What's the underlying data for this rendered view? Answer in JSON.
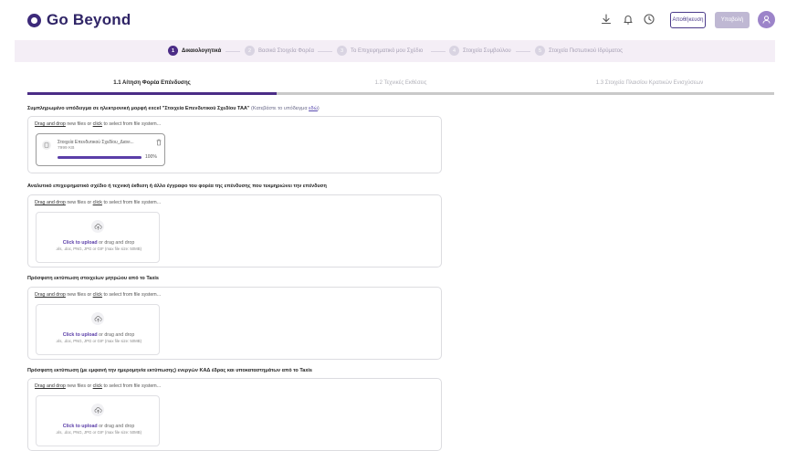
{
  "app": {
    "name": "Go Beyond"
  },
  "header": {
    "save_label": "Αποθήκευση",
    "submit_label": "Υποβολή",
    "icons": [
      "download-icon",
      "bell-icon",
      "clock-icon",
      "user-icon"
    ]
  },
  "steps": [
    {
      "num": "1",
      "label": "Δικαιολογητικά"
    },
    {
      "num": "2",
      "label": "Βασικά Στοιχεία Φορέα"
    },
    {
      "num": "3",
      "label": "Το Επιχειρηματικό μου Σχέδιο"
    },
    {
      "num": "4",
      "label": "Στοιχεία Συμβούλου"
    },
    {
      "num": "5",
      "label": "Στοιχεία Πιστωτικού Ιδρύματος"
    }
  ],
  "subtabs": [
    {
      "label": "1.1 Αίτηση Φορέα Επένδυσης"
    },
    {
      "label": "1.2 Τεχνικές Εκθέσεις"
    },
    {
      "label": "1.3 Στοιχεία Πλαισίου Κρατικών Ενισχύσεων"
    }
  ],
  "sections": [
    {
      "title": "Συμπληρωμένο υπόδειγμα σε ηλεκτρονική μορφή excel \"Στοιχεία Επενδυτικού Σχεδίου ΤΑΑ\"",
      "note_prefix": "(Κατεβάστε το υπόδειγμα",
      "note_link": "εδώ",
      "note_suffix": ")",
      "hint_drag": "Drag and drop",
      "hint_mid": "new files or",
      "hint_click": "click",
      "hint_end": "to select from file system...",
      "file": {
        "name": "Στοιχεία Επενδυτικού Σχεδίου_Διανι...",
        "size": "7999 KB",
        "progress_label": "100%",
        "progress": 1.0
      }
    },
    {
      "title": "Αναλυτικό επιχειρηματικό σχέδιο ή τεχνική έκθεση ή άλλο έγγραφο του φορέα της επένδυσης που τεκμηριώνει την επένδυση",
      "hint_drag": "Drag and drop",
      "hint_mid": "new files or",
      "hint_click": "click",
      "hint_end": "to select from file system...",
      "upload_strong": "Click to upload",
      "upload_rest": "or drag and drop",
      "upload_types": ".xls, .doc, PNG, JPG or GIF (max file size: 50MB)"
    },
    {
      "title": "Πρόσφατη εκτύπωση στοιχείων μητρώου από το Taxis",
      "hint_drag": "Drag and drop",
      "hint_mid": "new files or",
      "hint_click": "click",
      "hint_end": "to select from file system...",
      "upload_strong": "Click to upload",
      "upload_rest": "or drag and drop",
      "upload_types": ".xls, .doc, PNG, JPG or GIF (max file size: 50MB)"
    },
    {
      "title": "Πρόσφατη εκτύπωση (με εμφανή την ημερομηνία εκτύπωσης) ενεργών ΚΑΔ έδρας και υποκαταστημάτων από το Taxis",
      "hint_drag": "Drag and drop",
      "hint_mid": "new files or",
      "hint_click": "click",
      "hint_end": "to select from file system...",
      "upload_strong": "Click to upload",
      "upload_rest": "or drag and drop",
      "upload_types": ".xls, .doc, PNG, JPG or GIF (max file size: 50MB)"
    }
  ],
  "colors": {
    "brand": "#2f2466",
    "accent": "#4b2c86",
    "steps_bg": "#f4eef6",
    "progress": "#5b3ea8"
  }
}
